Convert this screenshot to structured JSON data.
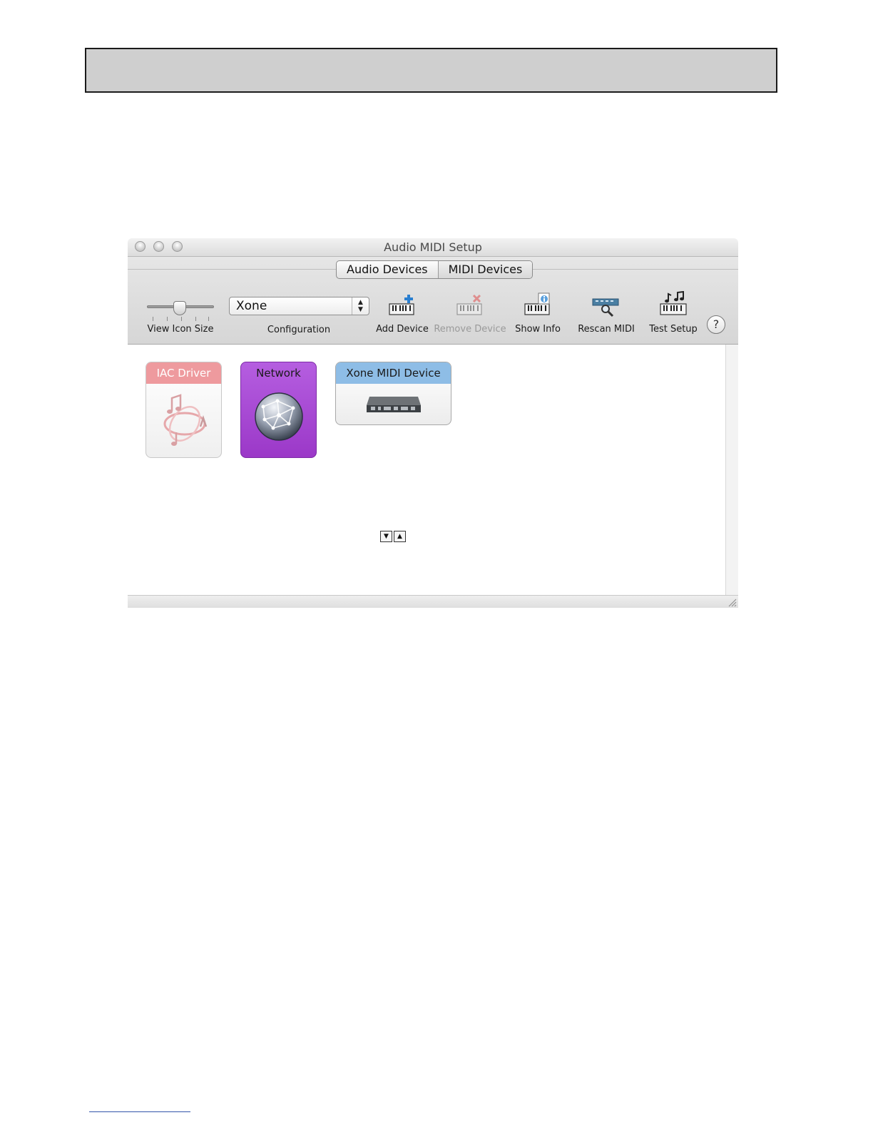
{
  "window": {
    "title": "Audio MIDI Setup"
  },
  "tabs": [
    {
      "label": "Audio Devices"
    },
    {
      "label": "MIDI Devices"
    }
  ],
  "toolbar": {
    "view_icon_size_label": "View Icon Size",
    "configuration": {
      "label": "Configuration",
      "value": "Xone"
    },
    "add_device_label": "Add Device",
    "remove_device_label": "Remove Device",
    "show_info_label": "Show Info",
    "rescan_midi_label": "Rescan MIDI",
    "test_setup_label": "Test Setup",
    "help_label": "?"
  },
  "devices": [
    {
      "name": "IAC Driver",
      "icon": "music-note-swirl-icon",
      "color": "#ee9a9e"
    },
    {
      "name": "Network",
      "icon": "globe-icon",
      "color": "#a445cf"
    },
    {
      "name": "Xone MIDI Device",
      "icon": "midi-interface-icon",
      "color": "#8ebde6"
    }
  ],
  "colors": {
    "remove_disabled": "#9a9a9a",
    "add_accent": "#2a7fd0",
    "remove_accent": "#e04040"
  }
}
